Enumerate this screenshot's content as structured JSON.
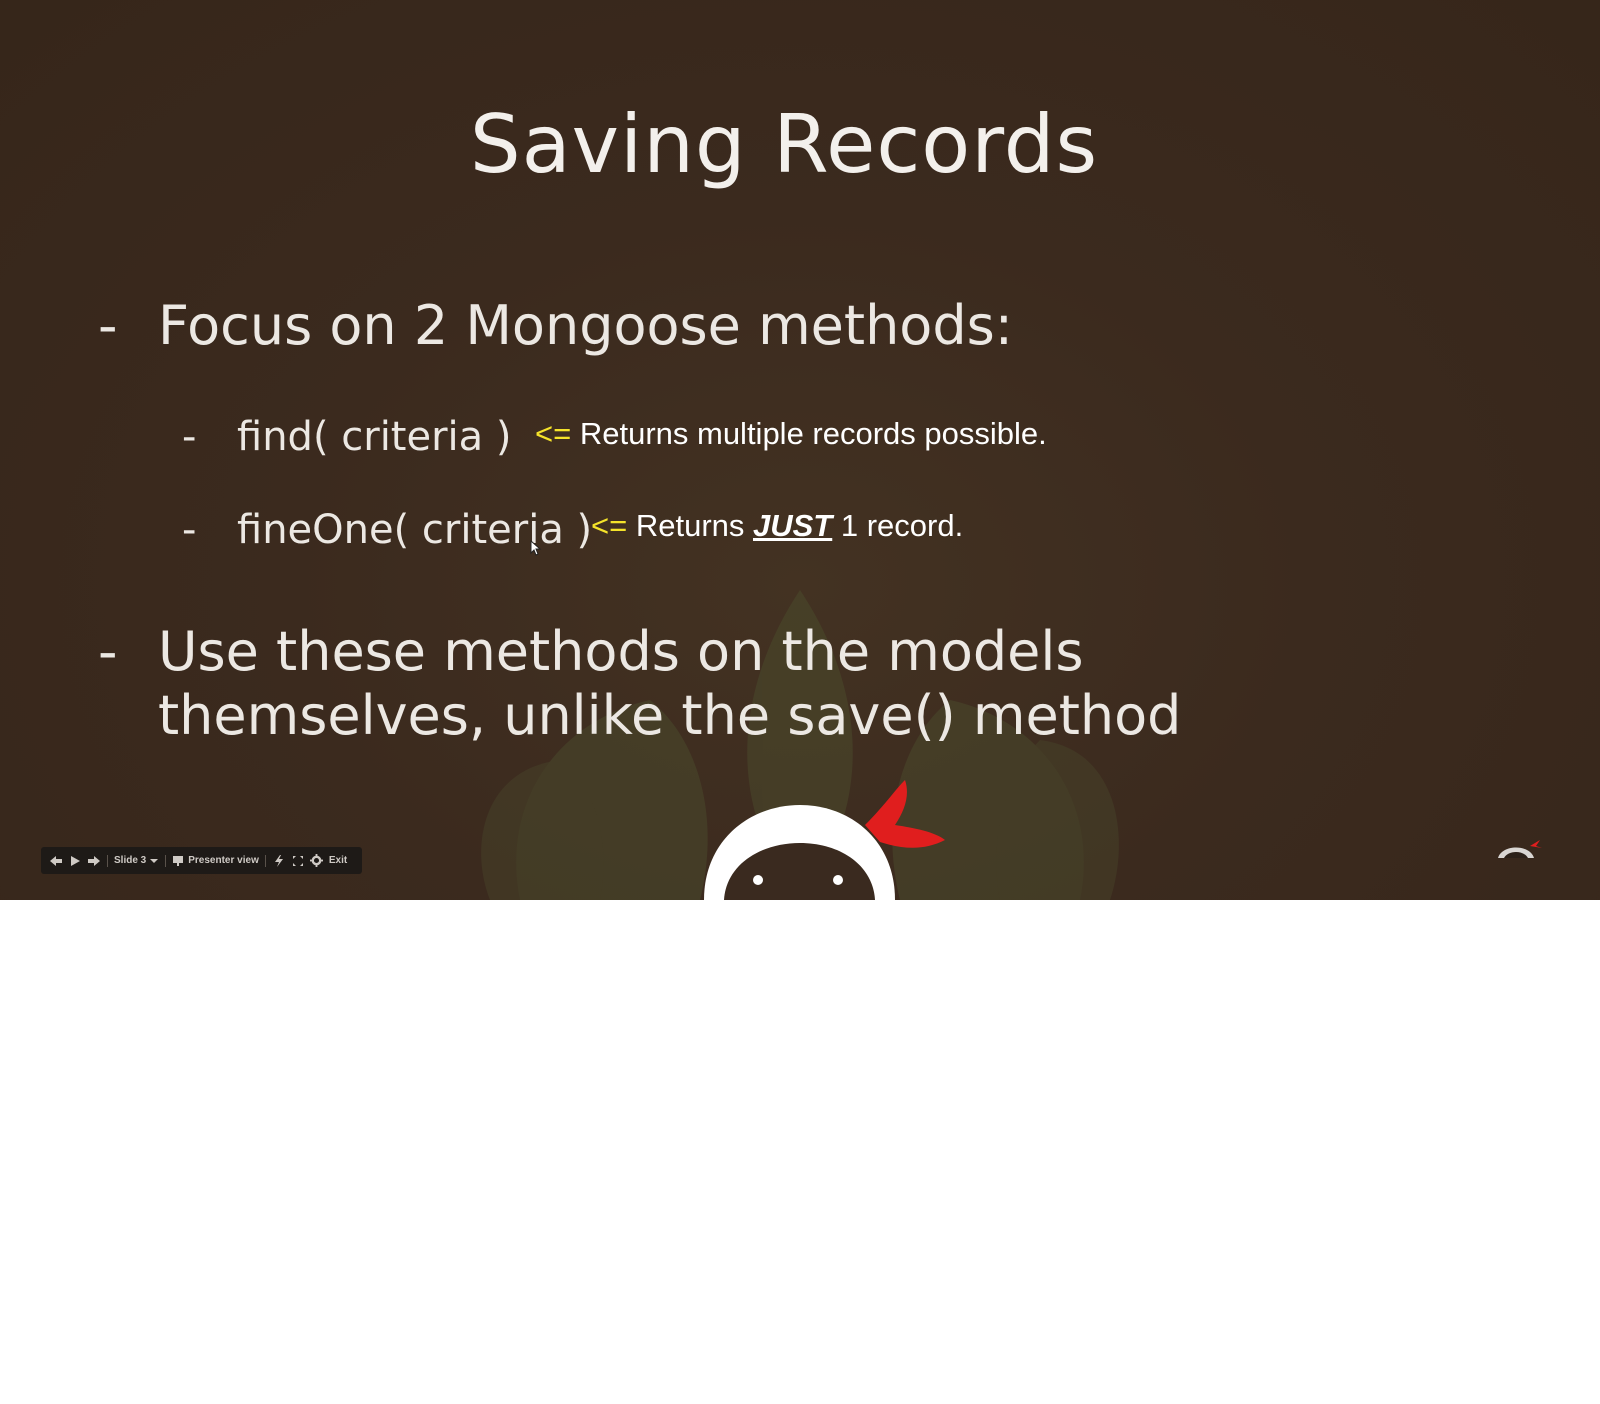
{
  "slide": {
    "title": "Saving Records",
    "bullets": [
      {
        "dash": "-",
        "text": "Focus on 2 Mongoose methods:"
      },
      {
        "dash": "-",
        "text": "Use these methods on the models themselves, unlike the save() method"
      }
    ],
    "sub_bullets": [
      {
        "dash": "-",
        "code": "find( criteria )",
        "note_arrow": "<=",
        "note_text": " Returns multiple records possible."
      },
      {
        "dash": "-",
        "code": "fineOne( criteria )",
        "note_arrow": "<=",
        "note_pre": " Returns ",
        "note_emph": "JUST",
        "note_post": " 1 record."
      }
    ]
  },
  "toolbar": {
    "slide_label": "Slide 3",
    "presenter_label": "Presenter view",
    "exit_label": "Exit",
    "icons": [
      "prev-arrow-icon",
      "play-icon",
      "next-arrow-icon",
      "chevron-down-icon",
      "presenter-screen-icon",
      "laser-pointer-icon",
      "fullscreen-icon",
      "gear-icon"
    ]
  },
  "colors": {
    "background": "#3b2a1e",
    "text": "#ece8e3",
    "arrow": "#f5e32a",
    "toolbar": "#1e1a17"
  }
}
